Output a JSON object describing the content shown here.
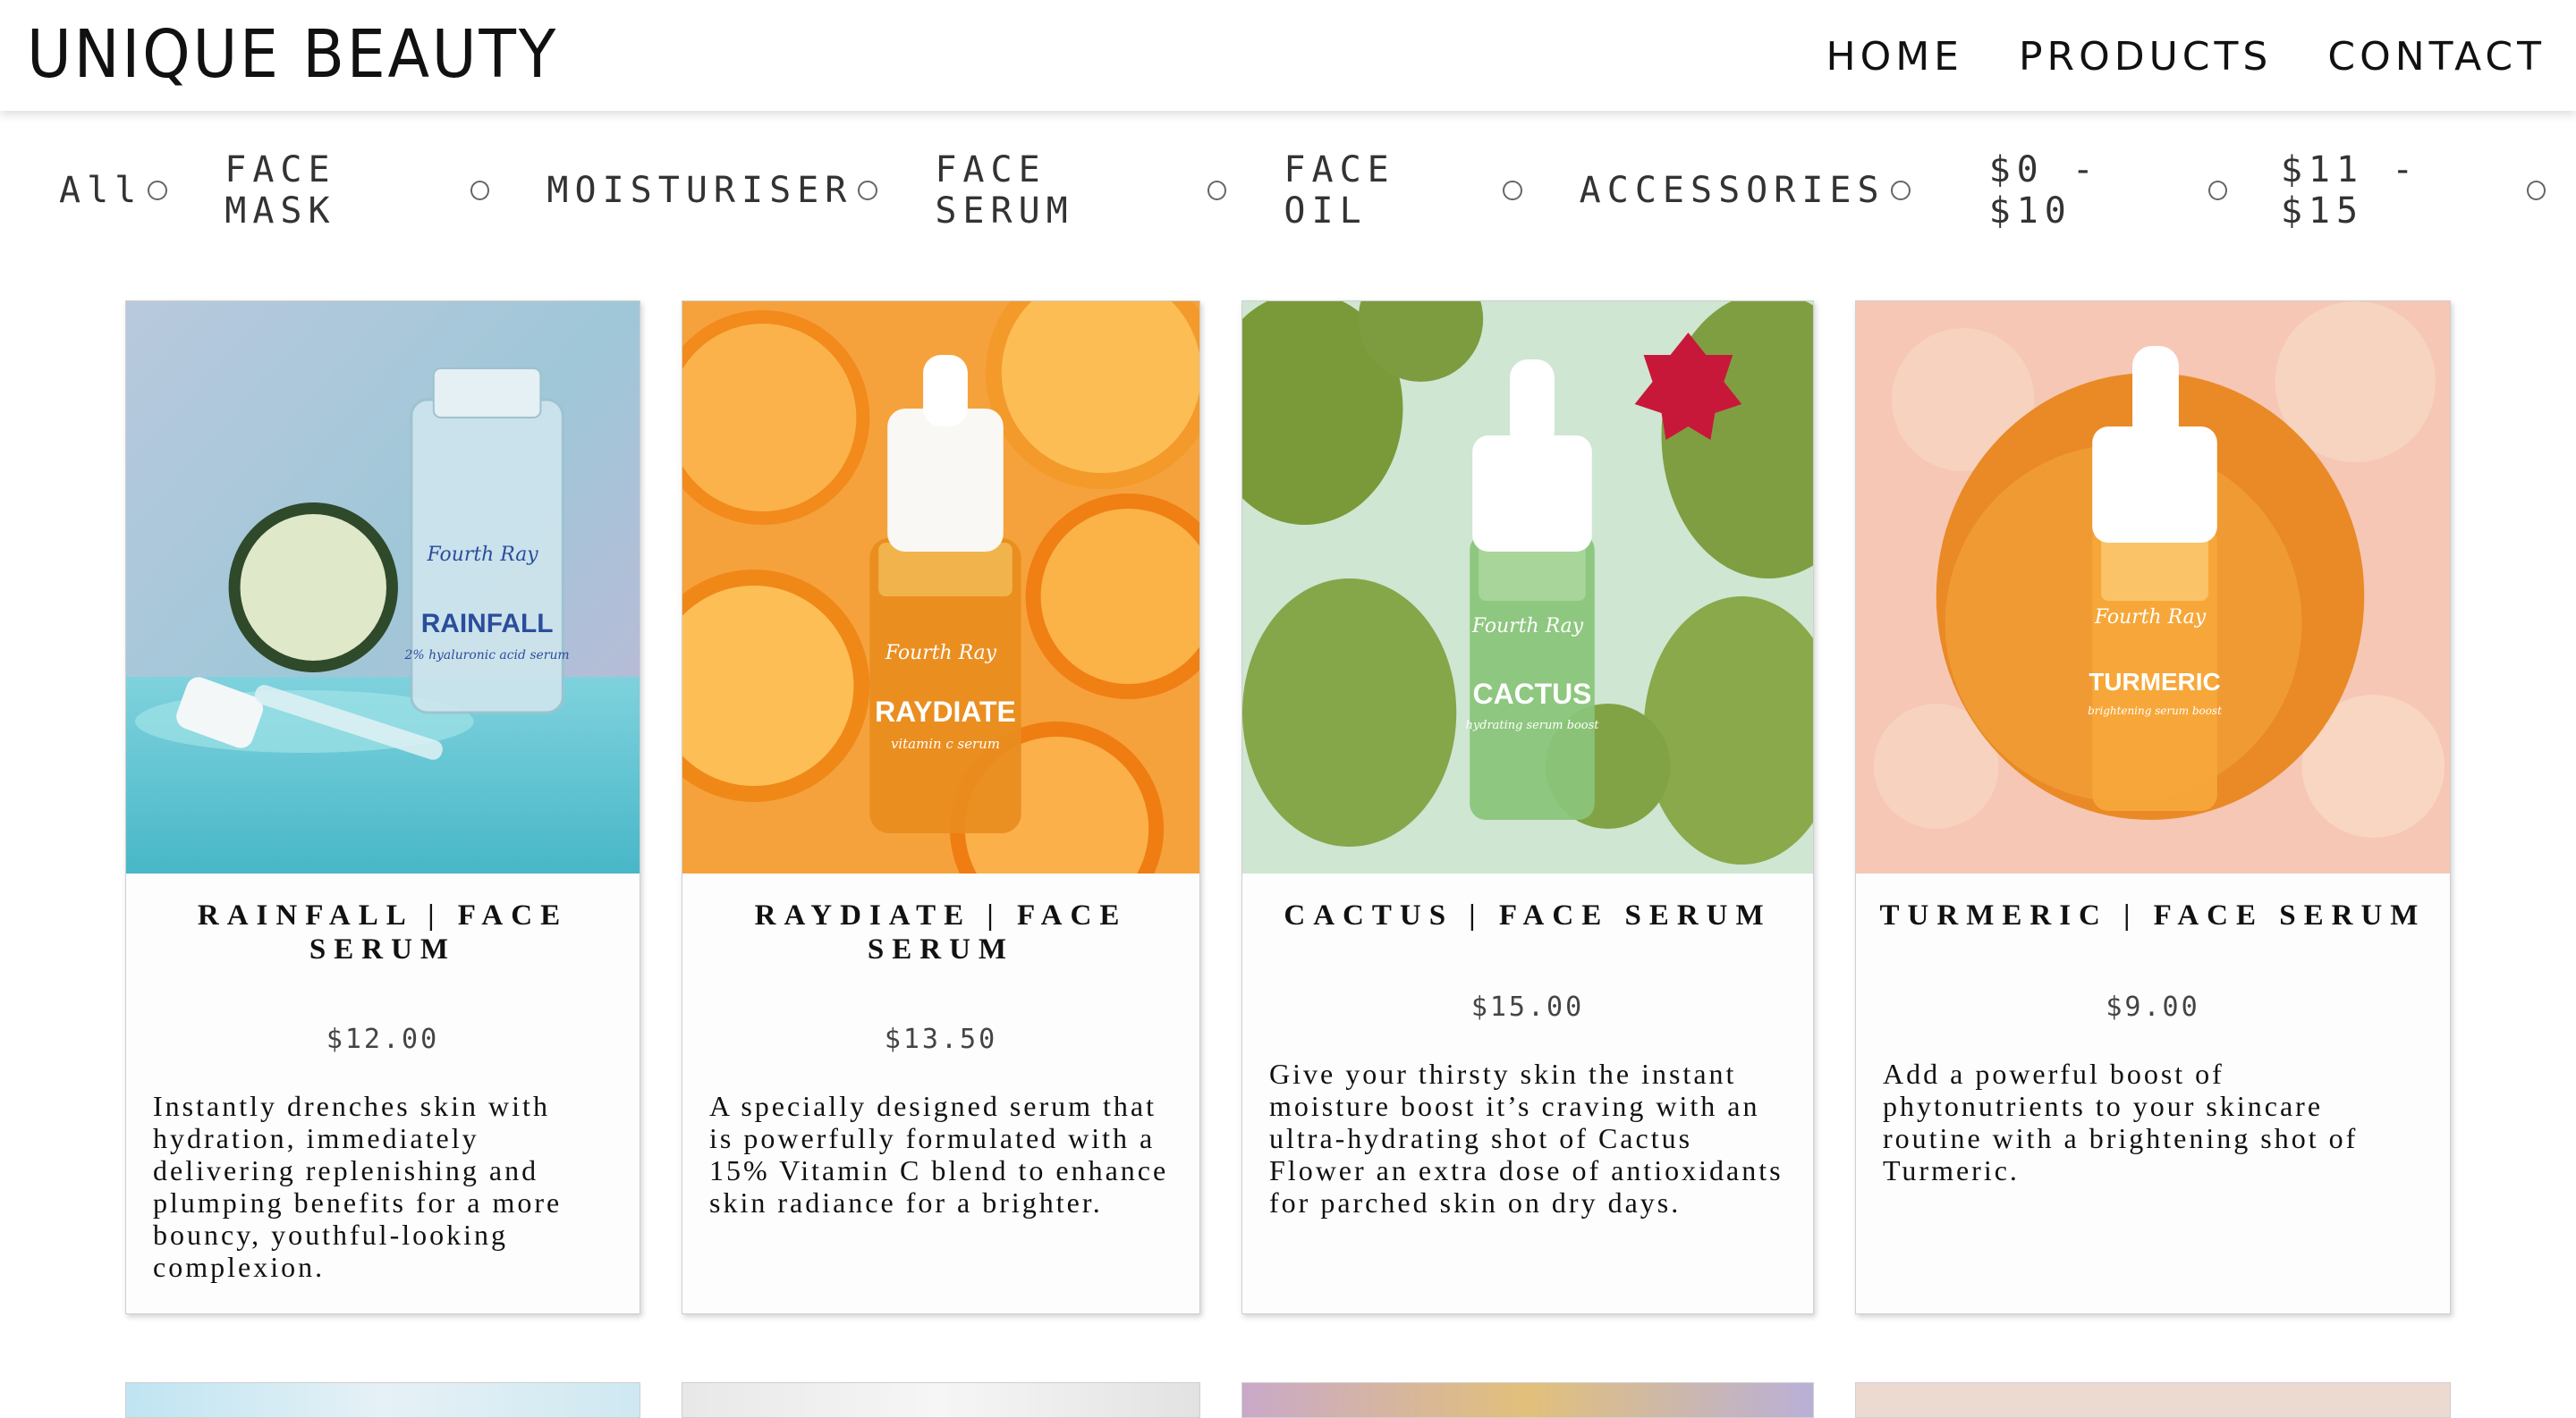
{
  "brand": "UNIQUE BEAUTY",
  "nav": [
    "HOME",
    "PRODUCTS",
    "CONTACT"
  ],
  "filters": {
    "categories": [
      "All",
      "FACE MASK",
      "MOISTURISER",
      "FACE SERUM",
      "FACE OIL",
      "ACCESSORIES"
    ],
    "prices": [
      "$0 - $10",
      "$11 - $15"
    ]
  },
  "products": [
    {
      "title": "RAINFALL | FACE SERUM",
      "price": "$12.00",
      "description": "Instantly drenches skin with hydration, immediately delivering replenishing and plumping benefits for a more bouncy, youthful-looking complexion.",
      "label": "RAINFALL",
      "sublabel": "2% hyaluronic acid serum",
      "script": "Fourth Ray"
    },
    {
      "title": "RAYDIATE | FACE SERUM",
      "price": "$13.50",
      "description": "A specially designed serum that is powerfully formulated with a 15% Vitamin C blend to enhance skin radiance for a brighter.",
      "label": "RAYDIATE",
      "sublabel": "vitamin c serum",
      "script": "Fourth Ray"
    },
    {
      "title": "CACTUS | FACE SERUM",
      "price": "$15.00",
      "description": "Give your thirsty skin the instant moisture boost it’s craving with an ultra-hydrating shot of Cactus Flower an extra dose of antioxidants for parched skin on dry days.",
      "label": "CACTUS",
      "sublabel": "hydrating serum boost",
      "script": "Fourth Ray"
    },
    {
      "title": "TURMERIC | FACE SERUM",
      "price": "$9.00",
      "description": "Add a powerful boost of phytonutrients to your skincare routine with a brightening shot of Turmeric.",
      "label": "TURMERIC",
      "sublabel": "brightening serum boost",
      "script": "Fourth Ray"
    }
  ],
  "colors": {
    "card1_bg": "#8fd3df",
    "card2_bg": "#f6a23c",
    "card3_bg": "#cfe6d2",
    "card4_bg": "#f6c7b5"
  }
}
